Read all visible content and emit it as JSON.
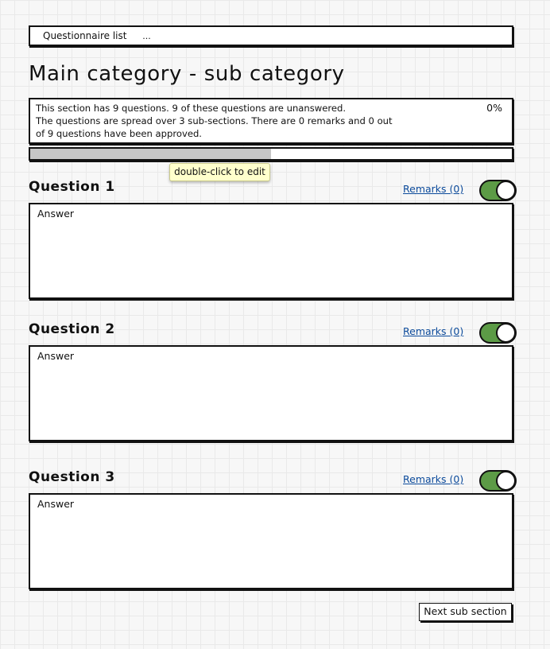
{
  "breadcrumb": {
    "link_label": "Questionnaire list",
    "ellipsis": "..."
  },
  "page_title": "Main category - sub category",
  "summary": {
    "line1": "This section has 9 questions. 9 of these questions are unanswered.",
    "line2": "The questions are spread over 3 sub-sections. There are 0 remarks and 0 out",
    "line3": "of 9 questions have been approved.",
    "percent_label": "0%"
  },
  "progress": {
    "fill_fraction": 0.5,
    "fill_color": "#c6c6c6"
  },
  "tooltip": "double-click to edit",
  "questions": [
    {
      "title": "Question 1",
      "remarks_label": "Remarks (0)",
      "toggle_on": true,
      "answer_placeholder": "Answer"
    },
    {
      "title": "Question 2",
      "remarks_label": "Remarks (0)",
      "toggle_on": true,
      "answer_placeholder": "Answer"
    },
    {
      "title": "Question 3",
      "remarks_label": "Remarks (0)",
      "toggle_on": true,
      "answer_placeholder": "Answer"
    }
  ],
  "next_button_label": "Next sub section",
  "colors": {
    "toggle_on": "#5c9b46",
    "link": "#0b4a9b",
    "tooltip_bg": "#ffffcc"
  }
}
